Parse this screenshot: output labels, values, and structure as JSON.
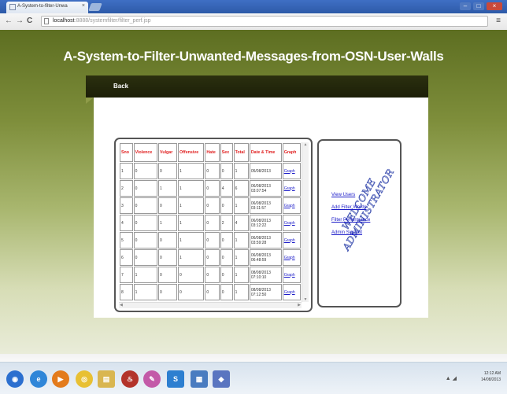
{
  "browser": {
    "tab_title": "A-System-to-filter-Unwa",
    "tab_close": "×",
    "url_host": "localhost",
    "url_path": ":8888/systemfilter/filter_perf.jsp",
    "nav_back": "←",
    "nav_forward": "→",
    "nav_reload": "C",
    "menu": "≡",
    "window_controls": [
      "–",
      "□",
      "×"
    ]
  },
  "page": {
    "site_title": "A-System-to-Filter-Unwanted-Messages-from-OSN-User-Walls",
    "back_link": "Back"
  },
  "table": {
    "headers": [
      "Sno",
      "Violence",
      "Vulgar",
      "Offensive",
      "Hate",
      "Sex",
      "Total",
      "Date & Time",
      "Graph"
    ],
    "rows": [
      {
        "sno": "1",
        "violence": "0",
        "vulgar": "0",
        "offensive": "1",
        "hate": "0",
        "sex": "0",
        "total": "1",
        "date": "05/08/2013",
        "time": "",
        "graph": "Graph"
      },
      {
        "sno": "2",
        "violence": "0",
        "vulgar": "1",
        "offensive": "1",
        "hate": "0",
        "sex": "4",
        "total": "6",
        "date": "06/08/2013",
        "time": "03:07:54",
        "graph": "Graph"
      },
      {
        "sno": "3",
        "violence": "0",
        "vulgar": "0",
        "offensive": "1",
        "hate": "0",
        "sex": "0",
        "total": "1",
        "date": "06/08/2013",
        "time": "03:11:57",
        "graph": "Graph"
      },
      {
        "sno": "4",
        "violence": "0",
        "vulgar": "1",
        "offensive": "1",
        "hate": "0",
        "sex": "2",
        "total": "4",
        "date": "06/08/2013",
        "time": "03:12:22",
        "graph": "Graph"
      },
      {
        "sno": "5",
        "violence": "0",
        "vulgar": "0",
        "offensive": "1",
        "hate": "0",
        "sex": "0",
        "total": "1",
        "date": "06/08/2013",
        "time": "03:59:28",
        "graph": "Graph"
      },
      {
        "sno": "6",
        "violence": "0",
        "vulgar": "0",
        "offensive": "1",
        "hate": "0",
        "sex": "0",
        "total": "1",
        "date": "06/08/2013",
        "time": "06:48:59",
        "graph": "Graph"
      },
      {
        "sno": "7",
        "violence": "1",
        "vulgar": "0",
        "offensive": "0",
        "hate": "0",
        "sex": "0",
        "total": "1",
        "date": "08/08/2013",
        "time": "07:10:10",
        "graph": "Graph"
      },
      {
        "sno": "8",
        "violence": "1",
        "vulgar": "0",
        "offensive": "0",
        "hate": "0",
        "sex": "0",
        "total": "1",
        "date": "08/08/2013",
        "time": "07:12:50",
        "graph": "Graph"
      }
    ],
    "scroll_up": "▲",
    "scroll_down": "▼",
    "scroll_left": "◀",
    "scroll_right": "▶"
  },
  "sidebar": {
    "links": [
      "View Users",
      "Add Filter Words",
      "Filter Performance",
      "Admin Signout"
    ],
    "watermark": "WELCOME ADMINISTRATOR"
  },
  "taskbar": {
    "time": "12:12 AM",
    "date": "14/08/2013",
    "tray": "▲ ◢"
  },
  "colors": {
    "header_text": "#e02020",
    "link": "#1a1ac8",
    "navbar": "#1c1f08",
    "page_top": "#5d6e21"
  }
}
